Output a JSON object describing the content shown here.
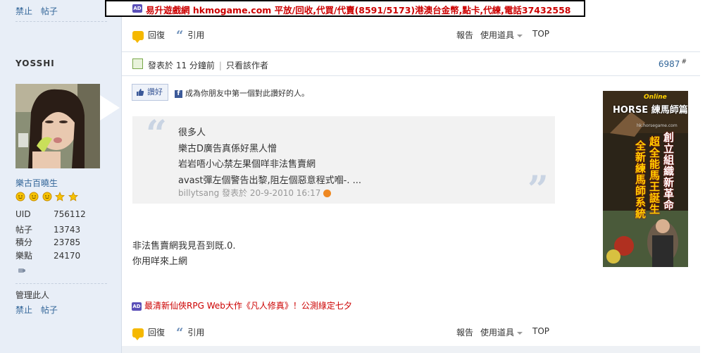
{
  "sidebar": {
    "top_links": [
      "禁止",
      "帖子"
    ],
    "username": "YOSSHI",
    "group": "樂古百曉生",
    "stats": [
      {
        "label": "UID",
        "value": "756112"
      },
      {
        "label": "帖子",
        "value": "13743"
      },
      {
        "label": "積分",
        "value": "23785"
      },
      {
        "label": "樂點",
        "value": "24170"
      }
    ],
    "manage_label": "管理此人",
    "bottom_links": [
      "禁止",
      "帖子"
    ]
  },
  "top_ad": {
    "badge": "AD",
    "text": "易升遊戲網 hkmogame.com 平放/回收,代買/代賣(8591/5173)港澳台金幣,點卡,代練,電話37432558"
  },
  "actionbar": {
    "reply": "回復",
    "quote": "引用",
    "report": "報告",
    "tools": "使用道具",
    "top": "TOP"
  },
  "post": {
    "meta": "發表於 11 分鐘前",
    "only_author": "只看該作者",
    "number": "6987",
    "number_mark": "#",
    "like_label": "讚好",
    "fb_text": "成為你朋友中第一個對此讚好的人。",
    "quote_lines": [
      "很多人",
      "樂古D廣告真係好黑人憎",
      "岩岩唔小心禁左果個咩非法售賣網",
      "avast彈左個警告出黎,阻左個惡意程式嗰-. ..."
    ],
    "quote_attr": "billytsang 發表於 20-9-2010 16:17",
    "body_lines": [
      "非法售賣網我見吾到既.0.",
      "你用咩來上網"
    ]
  },
  "inline_ad": {
    "badge": "AD",
    "text": "最清新仙俠RPG Web大作《凡人修真》！公測綠定七夕"
  },
  "side_ad": {
    "brand": "Online",
    "title": "HORSE 練馬師篇",
    "lines": [
      "創立組織新革命",
      "超全能馬王誕生",
      "全新練馬師系統"
    ],
    "url": "hk.horsegame.com"
  },
  "colors": {
    "sidebar_bg": "#e8eef7",
    "link": "#336699",
    "ad_red": "#cc0000",
    "quote_bg": "#f2f2f2"
  }
}
